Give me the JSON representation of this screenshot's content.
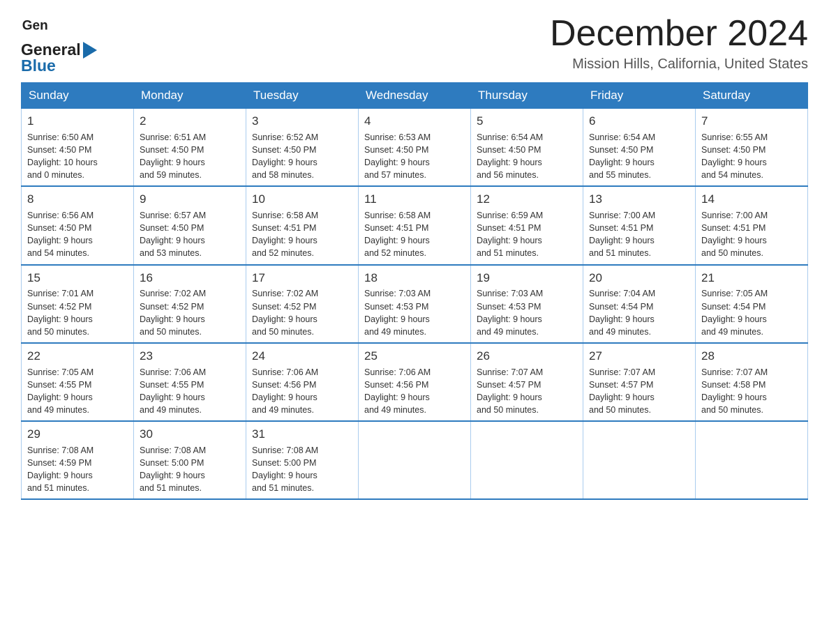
{
  "header": {
    "title": "December 2024",
    "subtitle": "Mission Hills, California, United States",
    "logo_general": "General",
    "logo_blue": "Blue"
  },
  "calendar": {
    "days_of_week": [
      "Sunday",
      "Monday",
      "Tuesday",
      "Wednesday",
      "Thursday",
      "Friday",
      "Saturday"
    ],
    "weeks": [
      [
        {
          "day": 1,
          "sunrise": "6:50 AM",
          "sunset": "4:50 PM",
          "daylight": "10 hours and 0 minutes."
        },
        {
          "day": 2,
          "sunrise": "6:51 AM",
          "sunset": "4:50 PM",
          "daylight": "9 hours and 59 minutes."
        },
        {
          "day": 3,
          "sunrise": "6:52 AM",
          "sunset": "4:50 PM",
          "daylight": "9 hours and 58 minutes."
        },
        {
          "day": 4,
          "sunrise": "6:53 AM",
          "sunset": "4:50 PM",
          "daylight": "9 hours and 57 minutes."
        },
        {
          "day": 5,
          "sunrise": "6:54 AM",
          "sunset": "4:50 PM",
          "daylight": "9 hours and 56 minutes."
        },
        {
          "day": 6,
          "sunrise": "6:54 AM",
          "sunset": "4:50 PM",
          "daylight": "9 hours and 55 minutes."
        },
        {
          "day": 7,
          "sunrise": "6:55 AM",
          "sunset": "4:50 PM",
          "daylight": "9 hours and 54 minutes."
        }
      ],
      [
        {
          "day": 8,
          "sunrise": "6:56 AM",
          "sunset": "4:50 PM",
          "daylight": "9 hours and 54 minutes."
        },
        {
          "day": 9,
          "sunrise": "6:57 AM",
          "sunset": "4:50 PM",
          "daylight": "9 hours and 53 minutes."
        },
        {
          "day": 10,
          "sunrise": "6:58 AM",
          "sunset": "4:51 PM",
          "daylight": "9 hours and 52 minutes."
        },
        {
          "day": 11,
          "sunrise": "6:58 AM",
          "sunset": "4:51 PM",
          "daylight": "9 hours and 52 minutes."
        },
        {
          "day": 12,
          "sunrise": "6:59 AM",
          "sunset": "4:51 PM",
          "daylight": "9 hours and 51 minutes."
        },
        {
          "day": 13,
          "sunrise": "7:00 AM",
          "sunset": "4:51 PM",
          "daylight": "9 hours and 51 minutes."
        },
        {
          "day": 14,
          "sunrise": "7:00 AM",
          "sunset": "4:51 PM",
          "daylight": "9 hours and 50 minutes."
        }
      ],
      [
        {
          "day": 15,
          "sunrise": "7:01 AM",
          "sunset": "4:52 PM",
          "daylight": "9 hours and 50 minutes."
        },
        {
          "day": 16,
          "sunrise": "7:02 AM",
          "sunset": "4:52 PM",
          "daylight": "9 hours and 50 minutes."
        },
        {
          "day": 17,
          "sunrise": "7:02 AM",
          "sunset": "4:52 PM",
          "daylight": "9 hours and 50 minutes."
        },
        {
          "day": 18,
          "sunrise": "7:03 AM",
          "sunset": "4:53 PM",
          "daylight": "9 hours and 49 minutes."
        },
        {
          "day": 19,
          "sunrise": "7:03 AM",
          "sunset": "4:53 PM",
          "daylight": "9 hours and 49 minutes."
        },
        {
          "day": 20,
          "sunrise": "7:04 AM",
          "sunset": "4:54 PM",
          "daylight": "9 hours and 49 minutes."
        },
        {
          "day": 21,
          "sunrise": "7:05 AM",
          "sunset": "4:54 PM",
          "daylight": "9 hours and 49 minutes."
        }
      ],
      [
        {
          "day": 22,
          "sunrise": "7:05 AM",
          "sunset": "4:55 PM",
          "daylight": "9 hours and 49 minutes."
        },
        {
          "day": 23,
          "sunrise": "7:06 AM",
          "sunset": "4:55 PM",
          "daylight": "9 hours and 49 minutes."
        },
        {
          "day": 24,
          "sunrise": "7:06 AM",
          "sunset": "4:56 PM",
          "daylight": "9 hours and 49 minutes."
        },
        {
          "day": 25,
          "sunrise": "7:06 AM",
          "sunset": "4:56 PM",
          "daylight": "9 hours and 49 minutes."
        },
        {
          "day": 26,
          "sunrise": "7:07 AM",
          "sunset": "4:57 PM",
          "daylight": "9 hours and 50 minutes."
        },
        {
          "day": 27,
          "sunrise": "7:07 AM",
          "sunset": "4:57 PM",
          "daylight": "9 hours and 50 minutes."
        },
        {
          "day": 28,
          "sunrise": "7:07 AM",
          "sunset": "4:58 PM",
          "daylight": "9 hours and 50 minutes."
        }
      ],
      [
        {
          "day": 29,
          "sunrise": "7:08 AM",
          "sunset": "4:59 PM",
          "daylight": "9 hours and 51 minutes."
        },
        {
          "day": 30,
          "sunrise": "7:08 AM",
          "sunset": "5:00 PM",
          "daylight": "9 hours and 51 minutes."
        },
        {
          "day": 31,
          "sunrise": "7:08 AM",
          "sunset": "5:00 PM",
          "daylight": "9 hours and 51 minutes."
        },
        null,
        null,
        null,
        null
      ]
    ],
    "labels": {
      "sunrise": "Sunrise: ",
      "sunset": "Sunset: ",
      "daylight": "Daylight: "
    }
  }
}
